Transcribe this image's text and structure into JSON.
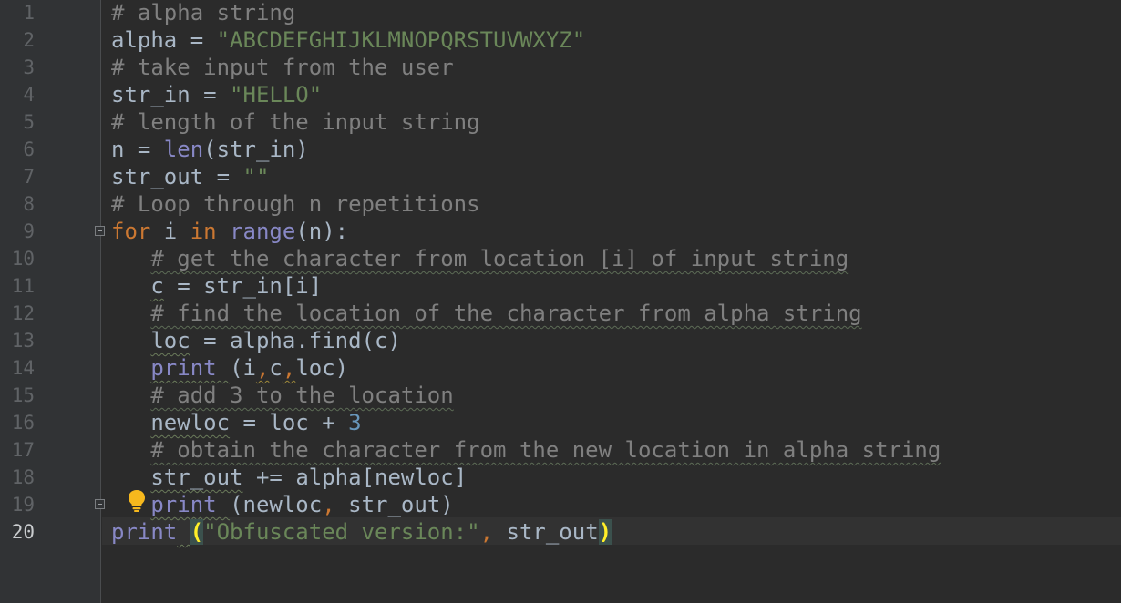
{
  "editor": {
    "line_numbers": [
      "1",
      "2",
      "3",
      "4",
      "5",
      "6",
      "7",
      "8",
      "9",
      "10",
      "11",
      "12",
      "13",
      "14",
      "15",
      "16",
      "17",
      "18",
      "19",
      "20"
    ],
    "current_line": "20",
    "icons": [
      "fold-marker-icon",
      "lightbulb-icon"
    ],
    "colors": {
      "background": "#2b2b2b",
      "gutter": "#313335",
      "comment": "#808080",
      "string": "#6a8759",
      "keyword": "#cc7832",
      "builtin": "#8888c6",
      "number": "#6897bb",
      "default": "#a9b7c6",
      "bracket_match": "#ffef28"
    },
    "lines": [
      {
        "t": [
          {
            "c": "cm",
            "v": "# alpha string"
          }
        ]
      },
      {
        "t": [
          {
            "c": "",
            "v": "alpha = "
          },
          {
            "c": "st",
            "v": "\"ABCDEFGHIJKLMNOPQRSTUVWXYZ\""
          }
        ]
      },
      {
        "t": [
          {
            "c": "cm",
            "v": "# take input from the user"
          }
        ]
      },
      {
        "t": [
          {
            "c": "",
            "v": "str_in = "
          },
          {
            "c": "st",
            "v": "\"HELLO\""
          }
        ]
      },
      {
        "t": [
          {
            "c": "cm",
            "v": "# length of the input string"
          }
        ]
      },
      {
        "t": [
          {
            "c": "",
            "v": "n = "
          },
          {
            "c": "bi",
            "v": "len"
          },
          {
            "c": "",
            "v": "(str_in)"
          }
        ]
      },
      {
        "t": [
          {
            "c": "",
            "v": "str_out = "
          },
          {
            "c": "st",
            "v": "\"\""
          }
        ]
      },
      {
        "t": [
          {
            "c": "cm",
            "v": "# Loop through n repetitions"
          }
        ]
      },
      {
        "t": [
          {
            "c": "kw",
            "v": "for"
          },
          {
            "c": "",
            "v": " i "
          },
          {
            "c": "kw",
            "v": "in"
          },
          {
            "c": "",
            "v": " "
          },
          {
            "c": "bi",
            "v": "range"
          },
          {
            "c": "",
            "v": "(n):"
          }
        ]
      },
      {
        "t": [
          {
            "c": "",
            "v": "   "
          },
          {
            "c": "cm wv",
            "v": "# get the character from location [i] of input string"
          }
        ]
      },
      {
        "t": [
          {
            "c": "",
            "v": "   "
          },
          {
            "c": "wvg",
            "v": "c"
          },
          {
            "c": "",
            "v": " = str_in[i]"
          }
        ]
      },
      {
        "t": [
          {
            "c": "",
            "v": "   "
          },
          {
            "c": "cm wv",
            "v": "# find the location of the character from alpha string"
          }
        ]
      },
      {
        "t": [
          {
            "c": "",
            "v": "   "
          },
          {
            "c": "wvg",
            "v": "loc"
          },
          {
            "c": "",
            "v": " = alpha.find(c)"
          }
        ]
      },
      {
        "t": [
          {
            "c": "",
            "v": "   "
          },
          {
            "c": "bi wvg",
            "v": "print "
          },
          {
            "c": "",
            "v": "(i"
          },
          {
            "c": "kw wvy",
            "v": ","
          },
          {
            "c": "",
            "v": "c"
          },
          {
            "c": "kw wvy",
            "v": ","
          },
          {
            "c": "",
            "v": "loc)"
          }
        ]
      },
      {
        "t": [
          {
            "c": "",
            "v": "   "
          },
          {
            "c": "cm wv",
            "v": "# add 3 to the location"
          }
        ]
      },
      {
        "t": [
          {
            "c": "",
            "v": "   "
          },
          {
            "c": "wvg",
            "v": "newloc"
          },
          {
            "c": "",
            "v": " = loc + "
          },
          {
            "c": "nm",
            "v": "3"
          }
        ]
      },
      {
        "t": [
          {
            "c": "",
            "v": "   "
          },
          {
            "c": "cm wv",
            "v": "# obtain the character from the new location in alpha string"
          }
        ]
      },
      {
        "t": [
          {
            "c": "",
            "v": "   "
          },
          {
            "c": "wvg",
            "v": "str_out"
          },
          {
            "c": "",
            "v": " += alpha[newloc]"
          }
        ]
      },
      {
        "t": [
          {
            "c": "",
            "v": "   "
          },
          {
            "c": "bi wvg",
            "v": "print "
          },
          {
            "c": "",
            "v": "(newloc"
          },
          {
            "c": "kw",
            "v": ","
          },
          {
            "c": "",
            "v": " str_out)"
          }
        ]
      },
      {
        "t": [
          {
            "c": "bi",
            "v": "print"
          },
          {
            "c": "wvg",
            "v": " "
          },
          {
            "c": "hl",
            "v": "("
          },
          {
            "c": "st",
            "v": "\"Obfuscated version:\""
          },
          {
            "c": "kw",
            "v": ","
          },
          {
            "c": "",
            "v": " str_out"
          },
          {
            "c": "hl",
            "v": ")"
          }
        ]
      }
    ]
  }
}
